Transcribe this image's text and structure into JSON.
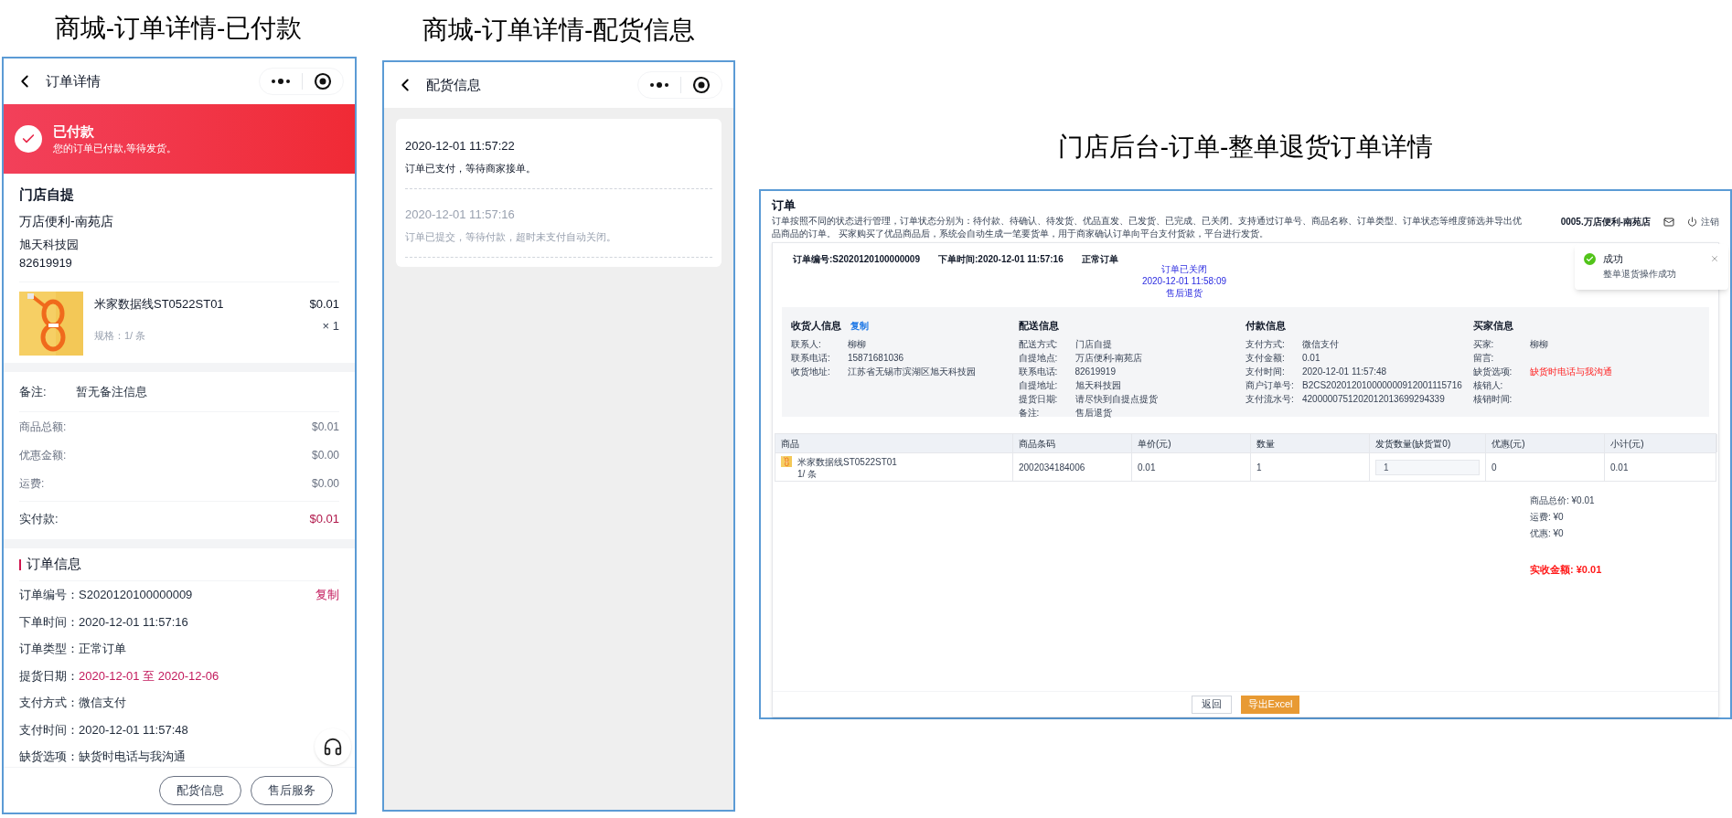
{
  "mall_paid": {
    "caption": "商城-订单详情-已付款",
    "nav": {
      "title": "订单详情"
    },
    "status": {
      "title": "已付款",
      "message": "您的订单已付款,等待发货。"
    },
    "pickup": {
      "heading": "门店自提",
      "store": "万店便利-南苑店",
      "address": "旭天科技园",
      "phone": "82619919"
    },
    "product": {
      "name": "米家数据线ST0522ST01",
      "spec": "规格：1/ 条",
      "price": "$0.01",
      "quantity": "× 1"
    },
    "remark": {
      "label": "备注:",
      "value": "暂无备注信息"
    },
    "amounts": [
      {
        "label": "商品总额:",
        "value": "$0.01",
        "kind": "normal"
      },
      {
        "label": "优惠金额:",
        "value": "$0.00",
        "kind": "normal"
      },
      {
        "label": "运费:",
        "value": "$0.00",
        "kind": "normal"
      },
      {
        "label": "实付款:",
        "value": "$0.01",
        "kind": "total"
      }
    ],
    "order_info": {
      "heading": "订单信息",
      "rows": [
        {
          "label": "订单编号：",
          "value": "S2020120100000009",
          "highlight": false,
          "action": "复制"
        },
        {
          "label": "下单时间：",
          "value": "2020-12-01 11:57:16",
          "highlight": false
        },
        {
          "label": "订单类型：",
          "value": "正常订单",
          "highlight": false
        },
        {
          "label": "提货日期：",
          "value": "2020-12-01 至 2020-12-06",
          "highlight": true
        },
        {
          "label": "支付方式：",
          "value": "微信支付",
          "highlight": false
        },
        {
          "label": "支付时间：",
          "value": "2020-12-01 11:57:48",
          "highlight": false
        },
        {
          "label": "缺货选项：",
          "value": "缺货时电话与我沟通",
          "highlight": false
        }
      ]
    },
    "buttons": [
      "配货信息",
      "售后服务"
    ]
  },
  "mall_delivery": {
    "caption": "商城-订单详情-配货信息",
    "nav": {
      "title": "配货信息"
    },
    "events": [
      {
        "time": "2020-12-01 11:57:22",
        "message": "订单已支付，等待商家接单。",
        "current": true
      },
      {
        "time": "2020-12-01 11:57:16",
        "message": "订单已提交，等待付款，超时未支付自动关闭。",
        "current": false
      }
    ]
  },
  "store_backend": {
    "caption": "门店后台-订单-整单退货订单详情",
    "page": {
      "title": "订单",
      "description": "订单按照不同的状态进行管理，订单状态分别为：待付款、待确认、待发货、优品直发、已发货、已完成、已关闭。支持通过订单号、商品名称、订单类型、订单状态等维度筛选并导出优品商品的订单。 买家购买了优品商品后，系统会自动生成一笔要货单，用于商家确认订单向平台支付货款，平台进行发货。"
    },
    "header": {
      "store": "0005.万店便利-南苑店",
      "logout": "注销"
    },
    "toast": {
      "title": "成功",
      "message": "整单退货操作成功"
    },
    "summary": {
      "order_no": "订单编号:S2020120100000009",
      "order_time": "下单时间:2020-12-01 11:57:16",
      "order_type": "正常订单",
      "status_lines": [
        "订单已关闭",
        "2020-12-01 11:58:09",
        "售后退货"
      ]
    },
    "info_sections": [
      {
        "heading": "收货人信息",
        "action": "复制",
        "rows": [
          {
            "label": "联系人:",
            "value": "柳柳"
          },
          {
            "label": "联系电话:",
            "value": "15871681036"
          },
          {
            "label": "收货地址:",
            "value": "江苏省无锡市滨湖区旭天科技园"
          }
        ]
      },
      {
        "heading": "配送信息",
        "rows": [
          {
            "label": "配送方式:",
            "value": "门店自提"
          },
          {
            "label": "自提地点:",
            "value": "万店便利-南苑店"
          },
          {
            "label": "联系电话:",
            "value": "82619919"
          },
          {
            "label": "自提地址:",
            "value": "旭天科技园"
          },
          {
            "label": "提货日期:",
            "value": "请尽快到自提点提货"
          },
          {
            "label": "备注:",
            "value": "售后退货"
          }
        ]
      },
      {
        "heading": "付款信息",
        "rows": [
          {
            "label": "支付方式:",
            "value": "微信支付"
          },
          {
            "label": "支付金额:",
            "value": "0.01"
          },
          {
            "label": "支付时间:",
            "value": "2020-12-01 11:57:48"
          },
          {
            "label": "商户订单号:",
            "value": "B2CS202012010000000912001115716"
          },
          {
            "label": "支付流水号:",
            "value": "4200000751202012013699294339"
          }
        ]
      },
      {
        "heading": "买家信息",
        "rows": [
          {
            "label": "买家:",
            "value": "柳柳"
          },
          {
            "label": "留言:"
          },
          {
            "label": "缺货选项:",
            "value": "缺货时电话与我沟通",
            "alert": true
          },
          {
            "label": "核销人:"
          },
          {
            "label": "核销时间:"
          }
        ]
      }
    ],
    "table": {
      "columns": [
        "商品",
        "商品条码",
        "单价(元)",
        "数量",
        "发货数量(缺货置0)",
        "优惠(元)",
        "小计(元)"
      ],
      "rows": [
        {
          "name": "米家数据线ST0522ST01",
          "spec": "1/ 条",
          "barcode": "2002034184006",
          "unit_price": "0.01",
          "quantity": "1",
          "ship_quantity": "1",
          "discount": "0",
          "subtotal": "0.01"
        }
      ]
    },
    "totals": [
      {
        "label": "商品总价:",
        "value": "¥0.01"
      },
      {
        "label": "运费:",
        "value": "¥0"
      },
      {
        "label": "优惠:",
        "value": "¥0"
      }
    ],
    "grand_total": {
      "label": "实收金额:",
      "value": "¥0.01"
    },
    "buttons": [
      {
        "label": "返回",
        "kind": "default"
      },
      {
        "label": "导出Excel",
        "kind": "primary"
      }
    ]
  }
}
